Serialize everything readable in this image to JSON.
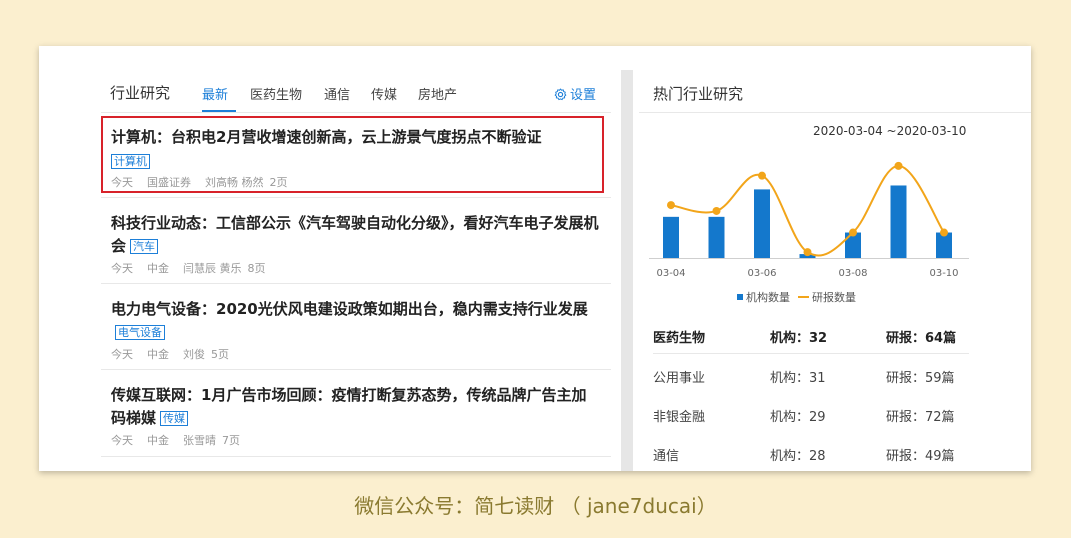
{
  "left_panel": {
    "title": "行业研究",
    "tabs": [
      "最新",
      "医药生物",
      "通信",
      "传媒",
      "房地产"
    ],
    "settings_label": "设置",
    "articles": [
      {
        "title": "计算机：台积电2月营收增速创新高，云上游景气度拐点不断验证",
        "tag": "计算机",
        "date": "今天",
        "broker": "国盛证券",
        "authors": "刘高畅  杨然",
        "pages": "2页"
      },
      {
        "title": "科技行业动态：工信部公示《汽车驾驶自动化分级》，看好汽车电子发展机会",
        "tag": "汽车",
        "date": "今天",
        "broker": "中金",
        "authors": "闫慧辰  黄乐",
        "pages": "8页"
      },
      {
        "title": "电力电气设备：2020光伏风电建设政策如期出台，稳内需支持行业发展",
        "tag": "电气设备",
        "date": "今天",
        "broker": "中金",
        "authors": "刘俊",
        "pages": "5页"
      },
      {
        "title": "传媒互联网：1月广告市场回顾：疫情打断复苏态势，传统品牌广告主加码梯媒",
        "tag": "传媒",
        "date": "今天",
        "broker": "中金",
        "authors": "张雪晴",
        "pages": "7页"
      }
    ]
  },
  "right_panel": {
    "title": "热门行业研究",
    "date_range": "2020-03-04 ~2020-03-10",
    "stats": [
      {
        "industry": "医药生物",
        "institutions": "机构：32",
        "reports": "研报：64篇"
      },
      {
        "industry": "公用事业",
        "institutions": "机构：31",
        "reports": "研报：59篇"
      },
      {
        "industry": "非银金融",
        "institutions": "机构：29",
        "reports": "研报：72篇"
      },
      {
        "industry": "通信",
        "institutions": "机构：28",
        "reports": "研报：49篇"
      }
    ]
  },
  "chart_data": {
    "type": "bar",
    "categories": [
      "03-04",
      "03-05",
      "03-06",
      "03-07",
      "03-08",
      "03-09",
      "03-10"
    ],
    "x_tick_labels": [
      "03-04",
      "03-06",
      "03-08",
      "03-10"
    ],
    "series": [
      {
        "name": "机构数量",
        "type": "bar",
        "color": "#1478cc",
        "values": [
          21,
          21,
          35,
          2,
          13,
          37,
          13
        ]
      },
      {
        "name": "研报数量",
        "type": "line",
        "color": "#f2a51a",
        "values": [
          27,
          24,
          42,
          3,
          13,
          47,
          13
        ]
      }
    ],
    "ylim": [
      0,
      50
    ],
    "legend": "bottom"
  },
  "footer": {
    "text": "微信公众号：简七读财 （ jane7ducai）"
  }
}
